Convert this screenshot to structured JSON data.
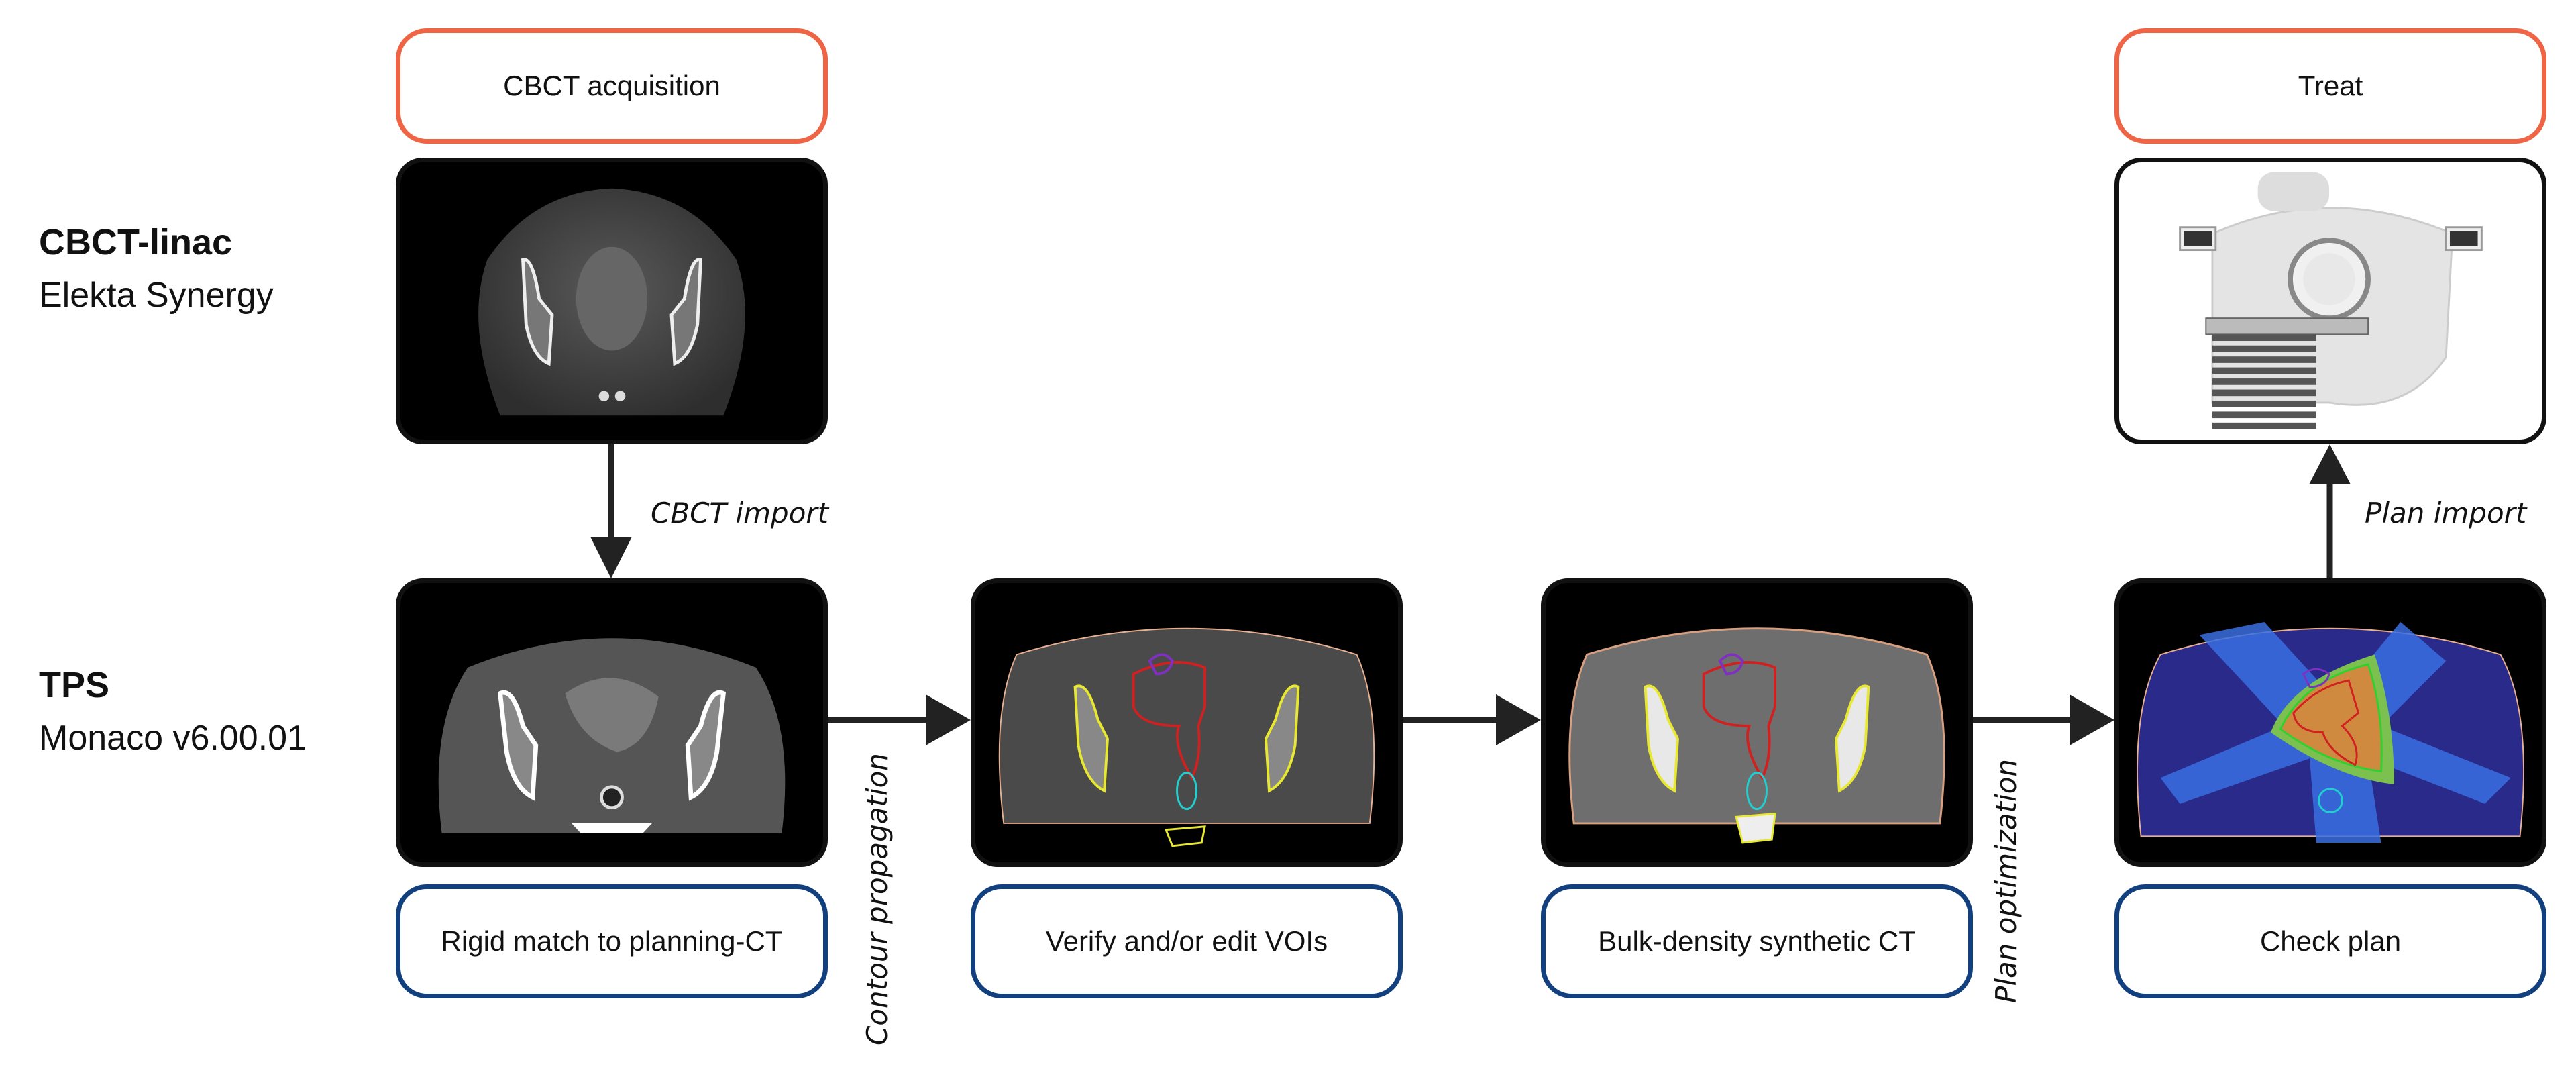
{
  "rows": {
    "linac": {
      "title": "CBCT-linac",
      "subtitle": "Elekta Synergy"
    },
    "tps": {
      "title": "TPS",
      "subtitle": "Monaco v6.00.01"
    }
  },
  "steps": {
    "acquisition": "CBCT acquisition",
    "treat": "Treat",
    "rigid_match": "Rigid match to planning-CT",
    "verify": "Verify and/or edit VOIs",
    "synthetic": "Bulk-density synthetic CT",
    "check": "Check plan"
  },
  "edges": {
    "cbct_import": "CBCT import",
    "contour_propagation": "Contour propagation",
    "plan_optimization": "Plan optimization",
    "plan_import": "Plan import"
  },
  "colors": {
    "linac_border": "#ee6444",
    "tps_border": "#123f7e",
    "arrow": "#222222",
    "contour_bone": "#e8e830",
    "contour_target": "#d02020",
    "contour_bladder": "#8030c0",
    "contour_rectum": "#20d0d0"
  }
}
